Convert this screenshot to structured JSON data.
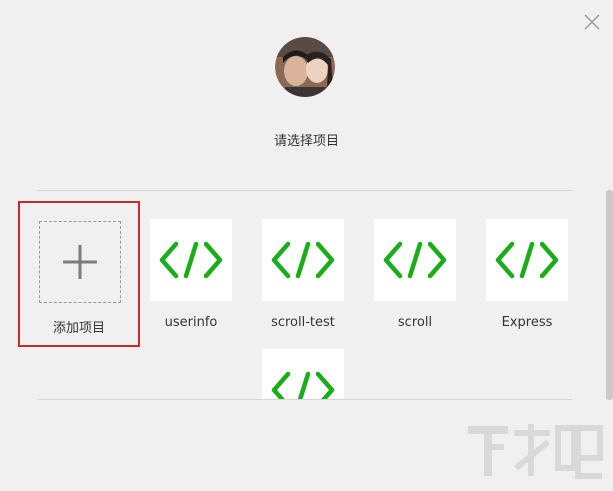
{
  "dialog": {
    "prompt": "请选择项目"
  },
  "projects": [
    {
      "label": "添加项目",
      "icon": "plus-icon"
    },
    {
      "label": "userinfo",
      "icon": "code-icon"
    },
    {
      "label": "scroll-test",
      "icon": "code-icon"
    },
    {
      "label": "scroll",
      "icon": "code-icon"
    },
    {
      "label": "Express",
      "icon": "code-icon"
    },
    {
      "label": "",
      "icon": "code-icon"
    }
  ],
  "colors": {
    "code_icon": "#1aad19",
    "selection_border": "#cc2a2a",
    "background": "#f0f0f0"
  },
  "watermark": {
    "text": "下载吧"
  }
}
